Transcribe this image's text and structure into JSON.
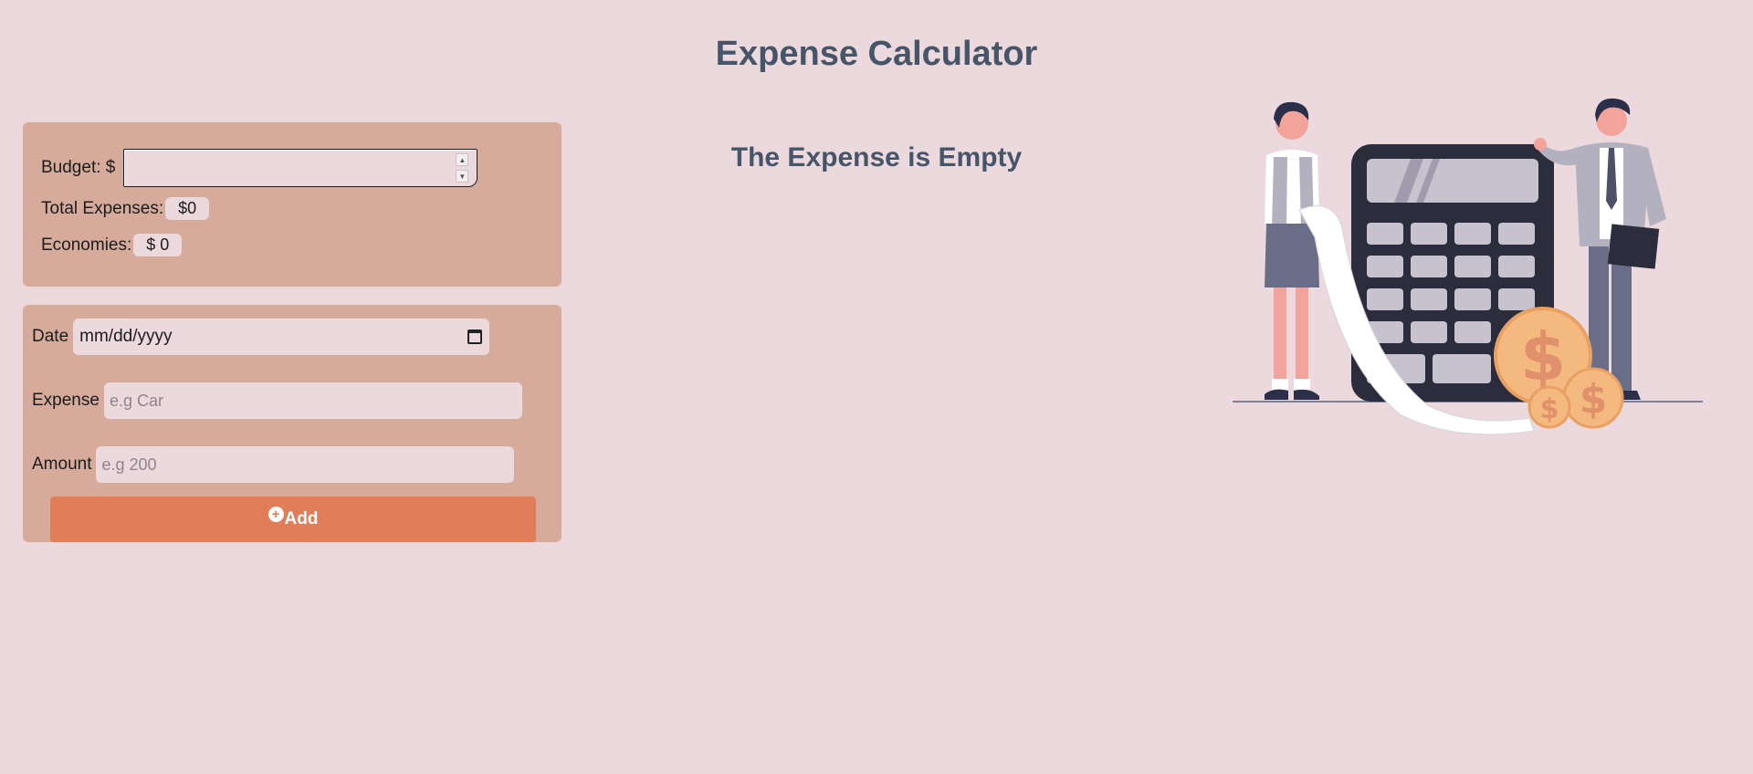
{
  "header": {
    "title": "Expense Calculator"
  },
  "main": {
    "empty_message": "The Expense is Empty"
  },
  "budget": {
    "label": "Budget: $",
    "value": "",
    "total_label": "Total Expenses:",
    "total_value": "$0",
    "economies_label": "Economies:",
    "economies_value": "$ 0"
  },
  "form": {
    "date_label": "Date",
    "date_placeholder": "mm/dd/yyyy",
    "expense_label": "Expense",
    "expense_placeholder": "e.g Car",
    "amount_label": "Amount",
    "amount_placeholder": "e.g 200",
    "add_label": "Add"
  },
  "colors": {
    "background": "#ecd9de",
    "card": "#d6ab9b",
    "accent": "#e07e5a",
    "title": "#475569"
  },
  "icons": [
    "calendar-icon",
    "plus-circle-icon",
    "spinner-up-icon",
    "spinner-down-icon"
  ]
}
